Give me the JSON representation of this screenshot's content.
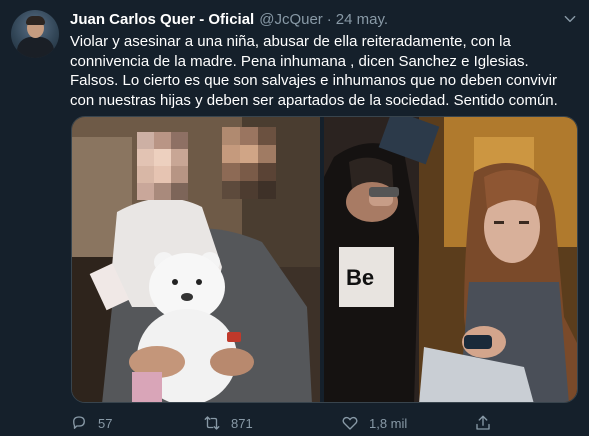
{
  "tweet": {
    "author_name": "Juan Carlos Quer - Oficial",
    "handle": "@JcQuer",
    "separator": "·",
    "date": "24 may.",
    "text": "Violar y asesinar a una niña, abusar de ella reiteradamente, con la connivencia de la madre. Pena inhumana , dicen Sanchez e Iglesias. Falsos. Lo cierto es que son salvajes e inhumanos que no deben convivir con nuestras hijas y deben ser apartados de la sociedad. Sentido común.",
    "photo_shirt_text": "Be"
  },
  "actions": {
    "replies": "57",
    "retweets": "871",
    "likes": "1,8 mil"
  },
  "icons": {
    "reply": "reply-icon",
    "retweet": "retweet-icon",
    "like": "heart-icon",
    "share": "share-icon",
    "more": "chevron-down-icon"
  },
  "colors": {
    "background": "#15202b",
    "text": "#ffffff",
    "secondary": "#8899a6",
    "border": "#38444d"
  }
}
